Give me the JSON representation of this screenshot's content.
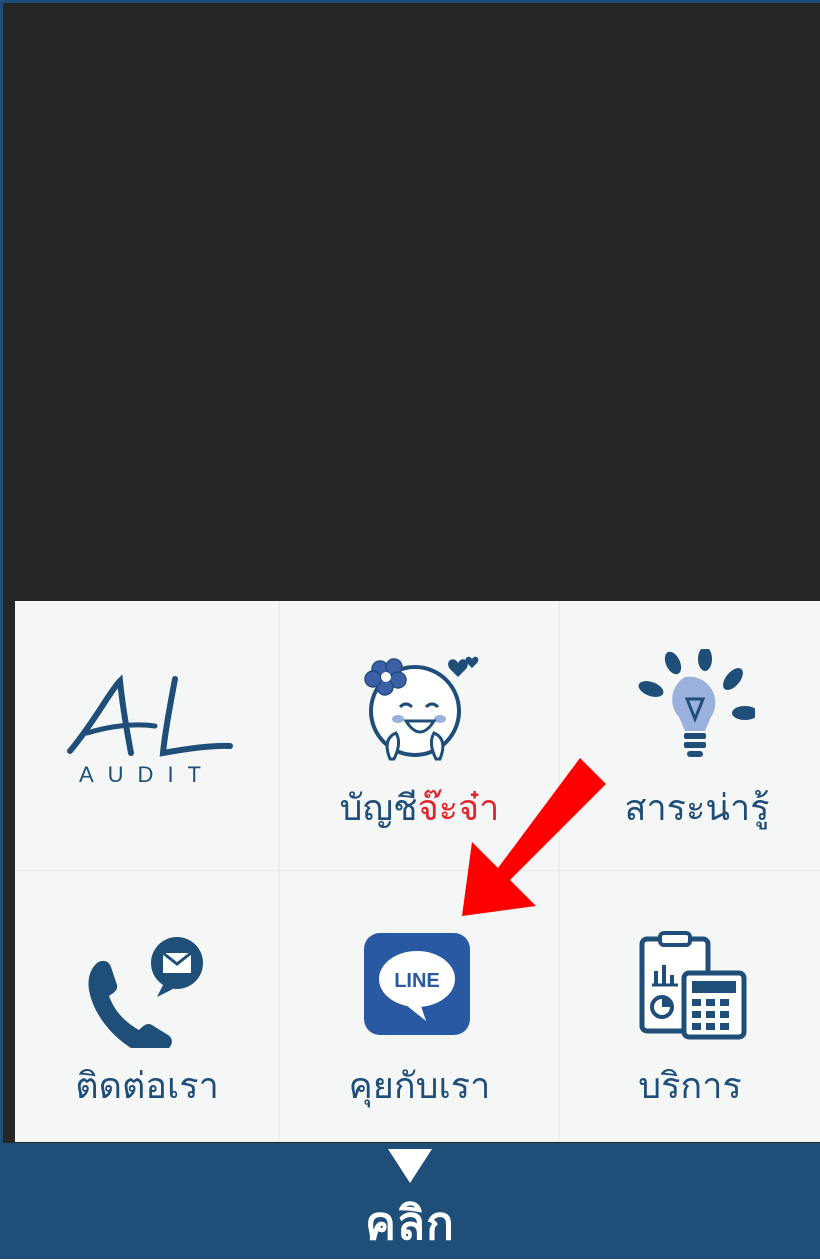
{
  "menu": {
    "logo": {
      "mark": "AL",
      "subtitle": "AUDIT"
    },
    "items": [
      {
        "label_main": "บัญชี",
        "label_accent": "จ๊ะจ๋า",
        "icon": "cartoon-face-icon"
      },
      {
        "label": "สาระน่ารู้",
        "icon": "lightbulb-icon"
      },
      {
        "label": "ติดต่อเรา",
        "icon": "phone-mail-icon"
      },
      {
        "label": "คุยกับเรา",
        "icon": "line-app-icon",
        "icon_text": "LINE"
      },
      {
        "label": "บริการ",
        "icon": "clipboard-calculator-icon"
      }
    ]
  },
  "bottom_bar": {
    "label": "คลิก",
    "icon": "triangle-down-icon"
  },
  "colors": {
    "dark_bg": "#262626",
    "brand_blue": "#1f4e79",
    "accent_red": "#e0262a",
    "arrow_red": "#ff0000",
    "grid_bg": "#f5f6f6"
  }
}
